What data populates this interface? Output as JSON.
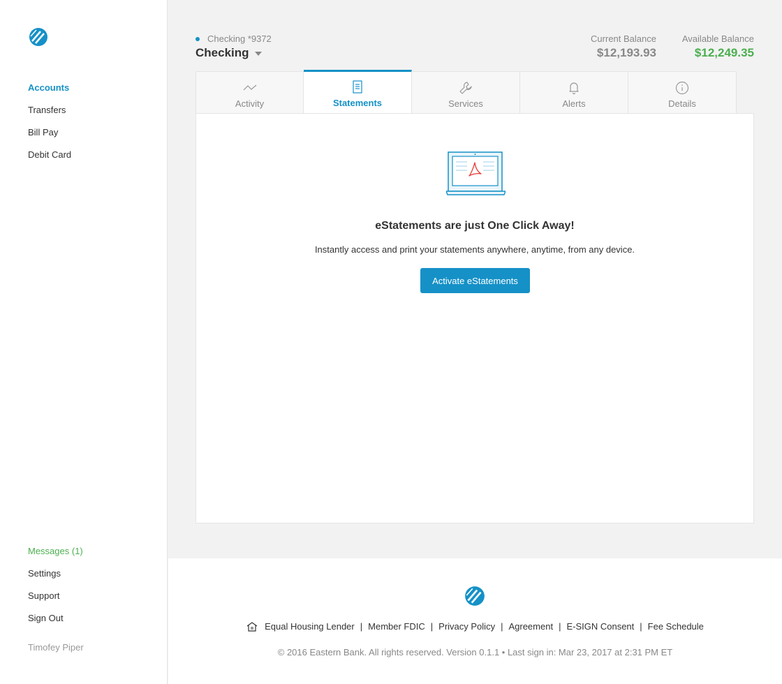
{
  "sidebar": {
    "logo": "eastern-bank-logo-icon",
    "nav_top": [
      {
        "label": "Accounts",
        "active": true
      },
      {
        "label": "Transfers"
      },
      {
        "label": "Bill Pay"
      },
      {
        "label": "Debit Card"
      }
    ],
    "nav_bottom": [
      {
        "label": "Messages (1)"
      },
      {
        "label": "Settings"
      },
      {
        "label": "Support"
      },
      {
        "label": "Sign Out"
      }
    ],
    "user_name": "Timofey Piper"
  },
  "account": {
    "number_label": "Checking *9372",
    "title": "Checking",
    "current_balance_label": "Current Balance",
    "current_balance": "$12,193.93",
    "available_balance_label": "Available Balance",
    "available_balance": "$12,249.35"
  },
  "tabs": [
    {
      "label": "Activity",
      "icon": "activity-chart-icon"
    },
    {
      "label": "Statements",
      "icon": "document-icon",
      "active": true
    },
    {
      "label": "Services",
      "icon": "wrench-icon"
    },
    {
      "label": "Alerts",
      "icon": "bell-icon"
    },
    {
      "label": "Details",
      "icon": "info-icon"
    }
  ],
  "statements": {
    "illustration": "laptop-pdf-icon",
    "title": "eStatements are just One Click Away!",
    "description": "Instantly access and print your statements anywhere, anytime, from any device.",
    "button": "Activate eStatements"
  },
  "footer": {
    "links": [
      "Equal Housing Lender",
      "Member FDIC",
      "Privacy Policy",
      "Agreement",
      "E-SIGN Consent",
      "Fee Schedule"
    ],
    "copyright": "© 2016 Eastern Bank. All rights reserved. Version 0.1.1 • Last sign in: Mar 23, 2017 at 2:31 PM ET"
  },
  "colors": {
    "accent": "#1591c7",
    "positive": "#4caf50",
    "muted": "#888888"
  }
}
